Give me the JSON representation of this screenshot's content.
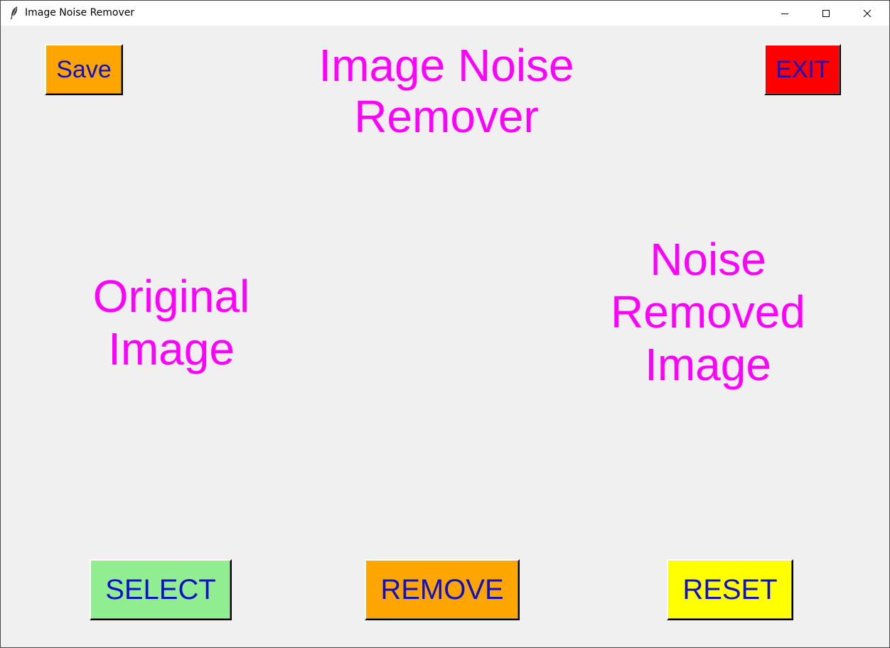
{
  "window": {
    "title": "Image Noise Remover",
    "icon": "feather-icon"
  },
  "controls": {
    "minimize_icon": "minimize-icon",
    "maximize_icon": "maximize-icon",
    "close_icon": "close-icon"
  },
  "header": {
    "title": "Image Noise\nRemover",
    "save_label": "Save",
    "exit_label": "EXIT"
  },
  "panels": {
    "original_label": "Original\nImage",
    "result_label": "Noise\nRemoved\nImage"
  },
  "actions": {
    "select_label": "SELECT",
    "remove_label": "REMOVE",
    "reset_label": "RESET"
  },
  "colors": {
    "title_text": "#ff00ff",
    "button_text": "#1010c8",
    "save_bg": "#ffa500",
    "exit_bg": "#ff0000",
    "select_bg": "#90ee90",
    "remove_bg": "#ffa500",
    "reset_bg": "#ffff00",
    "window_bg": "#f0f0f0"
  }
}
